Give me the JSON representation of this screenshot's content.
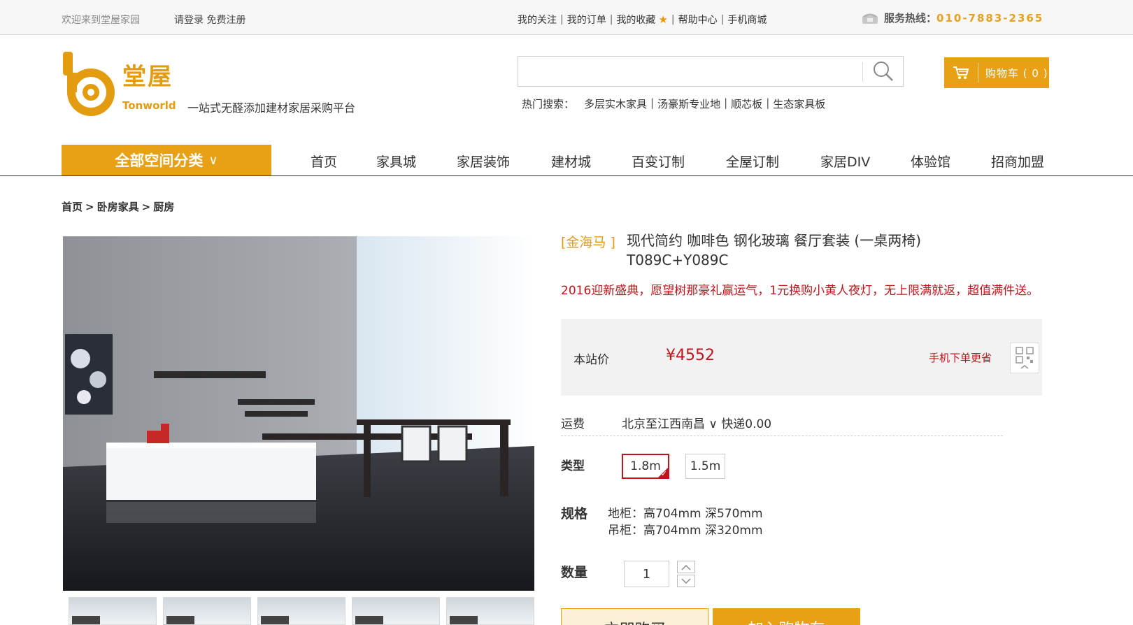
{
  "topbar": {
    "welcome": "欢迎来到堂屋家园",
    "login": "请登录",
    "register": "免费注册",
    "links": [
      "我的关注",
      "我的订单",
      "我的收藏",
      "帮助中心",
      "手机商城"
    ],
    "hotline_label": "服务热线：",
    "hotline_number": "010-7883-2365"
  },
  "header": {
    "brand_cn": "堂屋",
    "brand_en": "Tonworld",
    "slogan": "一站式无醛添加建材家居采购平台",
    "search_placeholder": "",
    "hot_label": "热门搜索：",
    "hot_items": [
      "多层实木家具",
      "汤豪斯专业地",
      "顺芯板",
      "生态家具板"
    ],
    "cart_label": "购物车 ( 0 )"
  },
  "nav": {
    "category": "全部空间分类",
    "category_chevron": "∨",
    "items": [
      "首页",
      "家具城",
      "家居装饰",
      "建材城",
      "百变订制",
      "全屋订制",
      "家居DIV",
      "体验馆",
      "招商加盟"
    ]
  },
  "breadcrumb": [
    "首页",
    "卧房家具",
    "厨房"
  ],
  "product": {
    "brand": "[金海马 ]",
    "title": "现代简约 咖啡色 钢化玻璃 餐厅套装 (一桌两椅) T089C+Y089C",
    "promo": "2016迎新盛典，愿望树那豪礼赢运气，1元换购小黄人夜灯，无上限满就返，超值满件送。",
    "price_label": "本站价",
    "price": "¥4552",
    "mobile_save": "手机下单更省",
    "shipping_label": "运费",
    "shipping_route": "北京至江西南昌",
    "shipping_chevron": "∨",
    "shipping_fee": "快递0.00",
    "type_label": "类型",
    "type_options": [
      "1.8m",
      "1.5m"
    ],
    "type_selected_index": 0,
    "spec_label": "规格",
    "spec_lines": [
      "地柜：高704mm 深570mm",
      "吊柜：高704mm 深320mm"
    ],
    "qty_label": "数量",
    "qty_value": "1",
    "buy_now": "立即购买",
    "add_to_cart": "加入购物车"
  },
  "colors": {
    "accent": "#e8a015",
    "price_red": "#c0141c",
    "brand_orange": "#e39c10"
  }
}
